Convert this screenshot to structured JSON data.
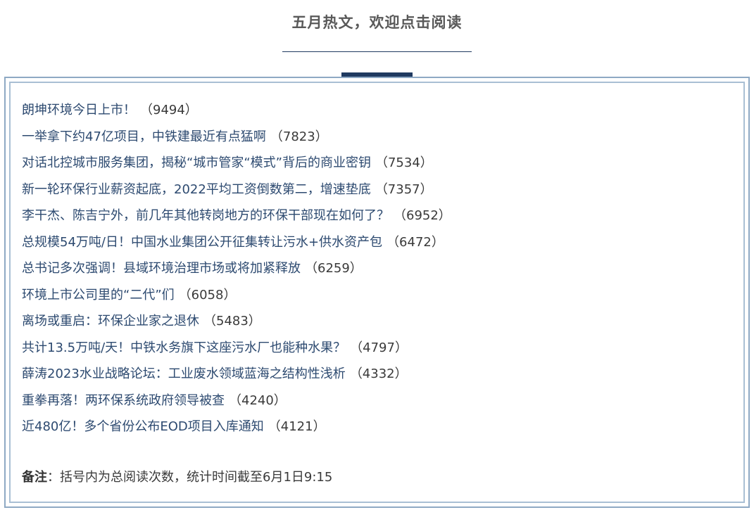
{
  "header": {
    "title": "五月热文，欢迎点击阅读"
  },
  "articles": [
    {
      "title": "朗坤环境今日上市！",
      "count": "（9494）"
    },
    {
      "title": "一举拿下约47亿项目，中铁建最近有点猛啊",
      "count": "（7823）"
    },
    {
      "title": "对话北控城市服务集团，揭秘“城市管家“模式”背后的商业密钥",
      "count": "（7534）"
    },
    {
      "title": "新一轮环保行业薪资起底，2022平均工资倒数第二，增速垫底",
      "count": "（7357）"
    },
    {
      "title": "李干杰、陈吉宁外，前几年其他转岗地方的环保干部现在如何了？",
      "count": "（6952）"
    },
    {
      "title": "总规模54万吨/日！中国水业集团公开征集转让污水+供水资产包",
      "count": "（6472）"
    },
    {
      "title": "总书记多次强调！县域环境治理市场或将加紧释放",
      "count": "（6259）"
    },
    {
      "title": "环境上市公司里的“二代”们",
      "count": "（6058）"
    },
    {
      "title": "离场或重启：环保企业家之退休",
      "count": "（5483）"
    },
    {
      "title": "共计13.5万吨/天！中铁水务旗下这座污水厂也能种水果？",
      "count": "（4797）"
    },
    {
      "title": "薛涛2023水业战略论坛：工业废水领域蓝海之结构性浅析",
      "count": "（4332）"
    },
    {
      "title": "重拳再落！两环保系统政府领导被查",
      "count": "（4240）"
    },
    {
      "title": "近480亿！多个省份公布EOD项目入库通知",
      "count": "（4121）"
    }
  ],
  "note": {
    "label": "备注",
    "text": "：括号内为总阅读次数，统计时间截至6月1日9:15"
  },
  "colors": {
    "accent": "#1f3a60",
    "frame_outer": "#8ea9c4",
    "frame_inner": "#a9bfd4",
    "title_text": "#595959"
  }
}
